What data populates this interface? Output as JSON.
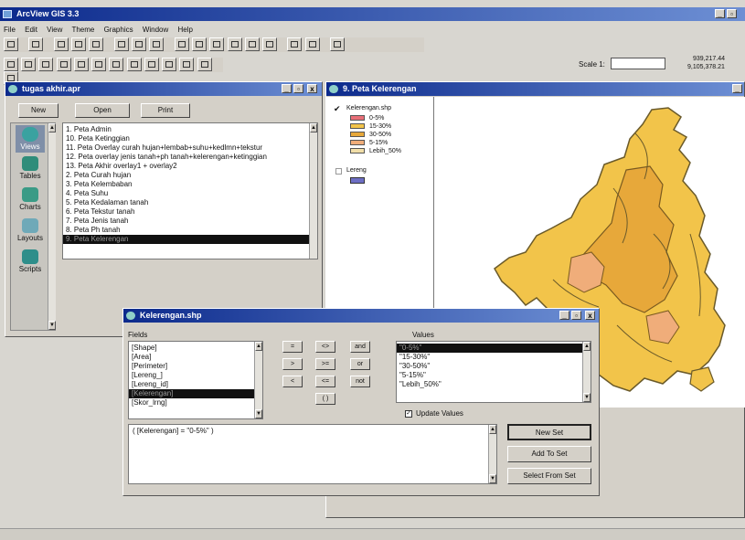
{
  "app": {
    "title": "ArcView GIS 3.3",
    "menus": [
      "File",
      "Edit",
      "View",
      "Theme",
      "Graphics",
      "Window",
      "Help"
    ],
    "scale_label": "Scale 1:",
    "scale_value": "",
    "coords": [
      "939,217.44",
      "9,105,378.21"
    ]
  },
  "project": {
    "title": "tugas akhir.apr",
    "buttons": {
      "new": "New",
      "open": "Open",
      "print": "Print"
    },
    "doc_types": [
      {
        "label": "Views",
        "icon": "views-icon"
      },
      {
        "label": "Tables",
        "icon": "tables-icon"
      },
      {
        "label": "Charts",
        "icon": "charts-icon"
      },
      {
        "label": "Layouts",
        "icon": "layouts-icon"
      },
      {
        "label": "Scripts",
        "icon": "scripts-icon"
      }
    ],
    "views": [
      "1. Peta Admin",
      "10. Peta Ketinggian",
      "11. Peta Overlay curah hujan+lembab+suhu+kedlmn+tekstur",
      "12. Peta overlay jenis tanah+ph tanah+kelerengan+ketinggian",
      "13. Peta Akhir overlay1 + overlay2",
      "2. Peta Curah hujan",
      "3. Peta Kelembaban",
      "4. Peta Suhu",
      "5. Peta Kedalaman tanah",
      "6. Peta Tekstur tanah",
      "7. Peta Jenis tanah",
      "8. Peta Ph tanah",
      "9. Peta Kelerengan"
    ],
    "selected_index": 12
  },
  "view": {
    "title": "9. Peta Kelerengan",
    "themes": [
      {
        "name": "Kelerengan.shp",
        "checked": true,
        "classes": [
          {
            "label": "0-5%",
            "color": "#e96f78"
          },
          {
            "label": "15-30%",
            "color": "#f2c44a"
          },
          {
            "label": "30-50%",
            "color": "#e7a83a"
          },
          {
            "label": "5-15%",
            "color": "#f0ad7a"
          },
          {
            "label": "Lebih_50%",
            "color": "#f1dea8"
          }
        ]
      },
      {
        "name": "Lereng",
        "checked": false,
        "classes": [
          {
            "label": "",
            "color": "#6d6ec4"
          }
        ]
      }
    ]
  },
  "query": {
    "title": "Kelerengan.shp",
    "fields_label": "Fields",
    "fields": [
      "[Shape]",
      "[Area]",
      "[Perimeter]",
      "[Lereng_]",
      "[Lereng_id]",
      "[Kelerengan]",
      "[Skor_lrng]"
    ],
    "selected_field": 5,
    "operators": [
      "=",
      "<>",
      "and",
      ">",
      ">=",
      "or",
      "<",
      "<=",
      "not",
      "( )"
    ],
    "values_label": "Values",
    "values": [
      "\"0-5%\"",
      "\"15-30%\"",
      "\"30-50%\"",
      "\"5-15%\"",
      "\"Lebih_50%\""
    ],
    "selected_value": 0,
    "update_values_label": "Update Values",
    "update_values_checked": true,
    "expression": "( [Kelerengan] = \"0-5%\" )",
    "buttons": {
      "new_set": "New Set",
      "add_to_set": "Add To Set",
      "select_from_set": "Select From Set"
    }
  }
}
